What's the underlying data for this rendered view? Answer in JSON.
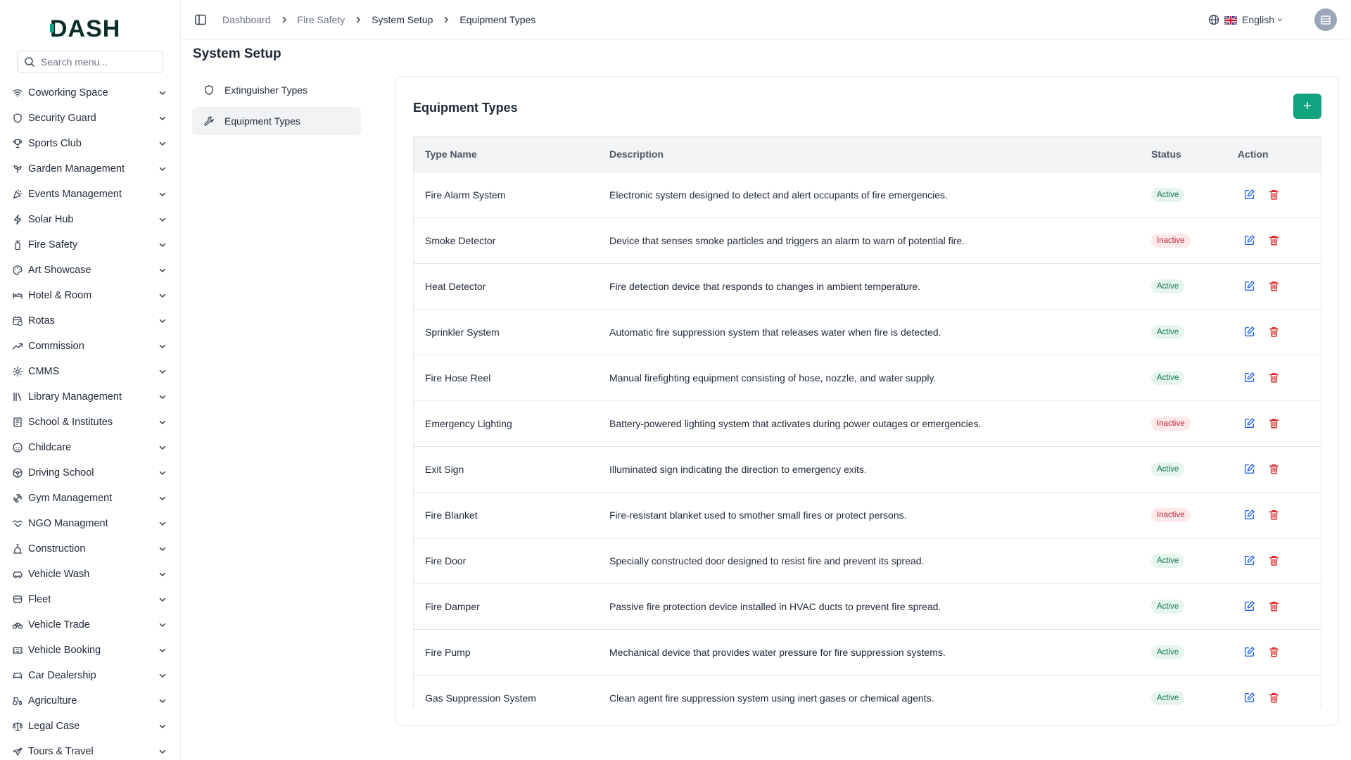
{
  "app": {
    "logo_text": "DASH",
    "brand_color": "#10a37f"
  },
  "sidebar": {
    "search_placeholder": "Search menu...",
    "items": [
      {
        "label": "Coworking Space",
        "icon": "wifi-icon"
      },
      {
        "label": "Security Guard",
        "icon": "shield-icon"
      },
      {
        "label": "Sports Club",
        "icon": "trophy-icon"
      },
      {
        "label": "Garden Management",
        "icon": "sprout-icon"
      },
      {
        "label": "Events Management",
        "icon": "party-icon"
      },
      {
        "label": "Solar Hub",
        "icon": "bolt-icon"
      },
      {
        "label": "Fire Safety",
        "icon": "fire-extinguisher-icon"
      },
      {
        "label": "Art Showcase",
        "icon": "palette-icon"
      },
      {
        "label": "Hotel & Room",
        "icon": "bed-icon"
      },
      {
        "label": "Rotas",
        "icon": "calendar-clock-icon"
      },
      {
        "label": "Commission",
        "icon": "trending-up-icon"
      },
      {
        "label": "CMMS",
        "icon": "cog-icon"
      },
      {
        "label": "Library Management",
        "icon": "library-icon"
      },
      {
        "label": "School & Institutes",
        "icon": "school-icon"
      },
      {
        "label": "Childcare",
        "icon": "baby-icon"
      },
      {
        "label": "Driving School",
        "icon": "steering-wheel-icon"
      },
      {
        "label": "Gym Management",
        "icon": "dumbbell-icon"
      },
      {
        "label": "NGO Managment",
        "icon": "handshake-icon"
      },
      {
        "label": "Construction",
        "icon": "construction-icon"
      },
      {
        "label": "Vehicle Wash",
        "icon": "car-icon"
      },
      {
        "label": "Fleet",
        "icon": "bus-icon"
      },
      {
        "label": "Vehicle Trade",
        "icon": "bike-icon"
      },
      {
        "label": "Vehicle Booking",
        "icon": "ticket-icon"
      },
      {
        "label": "Car Dealership",
        "icon": "car-front-icon"
      },
      {
        "label": "Agriculture",
        "icon": "tractor-icon"
      },
      {
        "label": "Legal Case",
        "icon": "scale-icon"
      },
      {
        "label": "Tours & Travel",
        "icon": "plane-icon"
      }
    ]
  },
  "topbar": {
    "breadcrumbs": [
      "Dashboard",
      "Fire Safety",
      "System Setup",
      "Equipment Types"
    ],
    "language": "English"
  },
  "page": {
    "title": "System Setup",
    "subnav": [
      {
        "label": "Extinguisher Types",
        "icon": "shield-icon"
      },
      {
        "label": "Equipment Types",
        "icon": "wrench-icon"
      }
    ]
  },
  "card": {
    "title": "Equipment Types",
    "add_label": "+"
  },
  "table": {
    "headers": {
      "name": "Type Name",
      "description": "Description",
      "status": "Status",
      "action": "Action"
    },
    "rows": [
      {
        "name": "Fire Alarm System",
        "description": "Electronic system designed to detect and alert occupants of fire emergencies.",
        "status": "Active"
      },
      {
        "name": "Smoke Detector",
        "description": "Device that senses smoke particles and triggers an alarm to warn of potential fire.",
        "status": "Inactive"
      },
      {
        "name": "Heat Detector",
        "description": "Fire detection device that responds to changes in ambient temperature.",
        "status": "Active"
      },
      {
        "name": "Sprinkler System",
        "description": "Automatic fire suppression system that releases water when fire is detected.",
        "status": "Active"
      },
      {
        "name": "Fire Hose Reel",
        "description": "Manual firefighting equipment consisting of hose, nozzle, and water supply.",
        "status": "Active"
      },
      {
        "name": "Emergency Lighting",
        "description": "Battery-powered lighting system that activates during power outages or emergencies.",
        "status": "Inactive"
      },
      {
        "name": "Exit Sign",
        "description": "Illuminated sign indicating the direction to emergency exits.",
        "status": "Active"
      },
      {
        "name": "Fire Blanket",
        "description": "Fire-resistant blanket used to smother small fires or protect persons.",
        "status": "Inactive"
      },
      {
        "name": "Fire Door",
        "description": "Specially constructed door designed to resist fire and prevent its spread.",
        "status": "Active"
      },
      {
        "name": "Fire Damper",
        "description": "Passive fire protection device installed in HVAC ducts to prevent fire spread.",
        "status": "Active"
      },
      {
        "name": "Fire Pump",
        "description": "Mechanical device that provides water pressure for fire suppression systems.",
        "status": "Active"
      },
      {
        "name": "Gas Suppression System",
        "description": "Clean agent fire suppression system using inert gases or chemical agents.",
        "status": "Active"
      }
    ]
  }
}
